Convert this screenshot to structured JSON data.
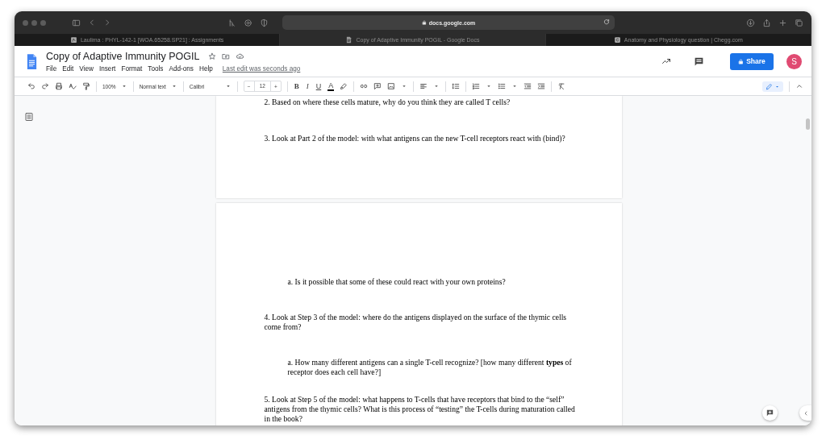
{
  "browser": {
    "address": "docs.google.com",
    "tabs": [
      {
        "title": "Laulima : PHYL-142-1 [WOA.65258.SP21] : Assignments",
        "kind": "laulima",
        "selected": false
      },
      {
        "title": "Copy of Adaptive Immunity POGIL - Google Docs",
        "kind": "docs",
        "selected": true
      },
      {
        "title": "Anatomy and Physiology question | Chegg.com",
        "kind": "chegg",
        "selected": false
      }
    ]
  },
  "header": {
    "title": "Copy of Adaptive Immunity POGIL",
    "menu": [
      "File",
      "Edit",
      "View",
      "Insert",
      "Format",
      "Tools",
      "Add-ons",
      "Help"
    ],
    "last_edit": "Last edit was seconds ago",
    "share_label": "Share",
    "avatar_letter": "S"
  },
  "toolbar": {
    "zoom": "100%",
    "style": "Normal text",
    "font": "Calibri",
    "font_size": "12",
    "minus": "−",
    "plus": "+",
    "format_buttons": [
      "B",
      "I",
      "U",
      "A"
    ]
  },
  "pages": [
    {
      "paragraphs": [
        {
          "kind": "question",
          "text": "2. Based on where these cells mature, why do you think they are called T cells?"
        },
        {
          "kind": "question",
          "text": "3. Look at Part 2 of the model: with what antigens can the new T-cell receptors react with (bind)?"
        }
      ]
    },
    {
      "paragraphs": [
        {
          "kind": "sub",
          "text": "a. Is it possible that some of these could react with your own proteins?"
        },
        {
          "kind": "question",
          "text": "4. Look at Step 3 of the model: where do the antigens displayed on the surface of the thymic cells come from?"
        },
        {
          "kind": "sub",
          "text": "a. How many different antigens can a single T-cell recognize? [how many different **types** of receptor does each cell have?]"
        },
        {
          "kind": "question",
          "text": "5. Look at Step 5 of the model: what happens to T-cells that have receptors that bind to the “self” antigens from the thymic cells?  What is this process of “testing” the T-cells during maturation called in the book?"
        }
      ]
    }
  ]
}
